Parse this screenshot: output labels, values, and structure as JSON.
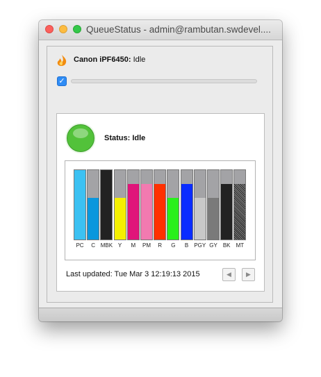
{
  "window": {
    "title": "QueueStatus - admin@rambutan.swdevel....",
    "controls": [
      "close",
      "minimize",
      "zoom"
    ]
  },
  "printer": {
    "icon": "flame-icon",
    "name": "Canon iPF6450:",
    "state": "Idle",
    "auto_refresh_checked": true,
    "progress": 0
  },
  "status": {
    "indicator_color": "#52c23a",
    "label": "Status: Idle"
  },
  "inks": [
    {
      "label": "PC",
      "color": "#3cc1f2",
      "level": 1.0,
      "pattern": false
    },
    {
      "label": "C",
      "color": "#0a97dd",
      "level": 0.6,
      "pattern": false
    },
    {
      "label": "MBK",
      "color": "#222222",
      "level": 1.0,
      "pattern": false
    },
    {
      "label": "Y",
      "color": "#f5f000",
      "level": 0.6,
      "pattern": false
    },
    {
      "label": "M",
      "color": "#e0157a",
      "level": 0.8,
      "pattern": false
    },
    {
      "label": "PM",
      "color": "#f27ab0",
      "level": 0.8,
      "pattern": false
    },
    {
      "label": "R",
      "color": "#ff3000",
      "level": 0.8,
      "pattern": false
    },
    {
      "label": "G",
      "color": "#29f01c",
      "level": 0.6,
      "pattern": false
    },
    {
      "label": "B",
      "color": "#0a2cff",
      "level": 0.8,
      "pattern": false
    },
    {
      "label": "PGY",
      "color": "#c8c8c8",
      "level": 0.6,
      "pattern": false
    },
    {
      "label": "GY",
      "color": "#7a7a7a",
      "level": 0.6,
      "pattern": false
    },
    {
      "label": "BK",
      "color": "#222222",
      "level": 0.8,
      "pattern": false
    },
    {
      "label": "MT",
      "color": "#3a3a3a",
      "level": 0.8,
      "pattern": true
    }
  ],
  "footer": {
    "last_updated": "Last updated: Tue Mar 3 12:19:13 2015",
    "prev_icon": "triangle-left-icon",
    "next_icon": "triangle-right-icon",
    "prev_glyph": "◀",
    "next_glyph": "▶"
  }
}
